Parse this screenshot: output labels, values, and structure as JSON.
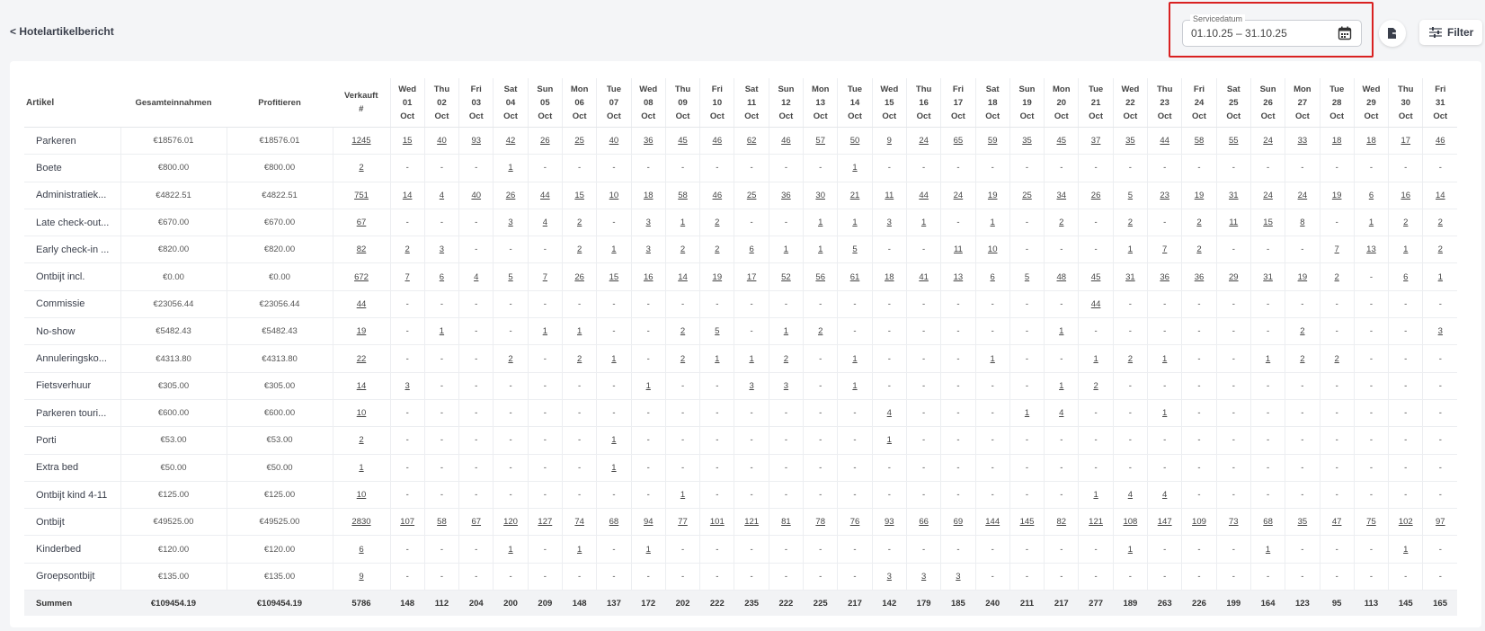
{
  "header": {
    "back_label": "< Hotelartikelbericht",
    "date_label": "Servicedatum",
    "date_range": "01.10.25 – 31.10.25",
    "filter_label": "Filter"
  },
  "table": {
    "col_artikel": "Artikel",
    "col_gesamt": "Gesamteinnahmen",
    "col_profit": "Profitieren",
    "col_verkauft": "Verkauft",
    "col_verkauft_sub": "#",
    "days": [
      {
        "name": "Wed",
        "num": "01",
        "mon": "Oct"
      },
      {
        "name": "Thu",
        "num": "02",
        "mon": "Oct"
      },
      {
        "name": "Fri",
        "num": "03",
        "mon": "Oct"
      },
      {
        "name": "Sat",
        "num": "04",
        "mon": "Oct"
      },
      {
        "name": "Sun",
        "num": "05",
        "mon": "Oct"
      },
      {
        "name": "Mon",
        "num": "06",
        "mon": "Oct"
      },
      {
        "name": "Tue",
        "num": "07",
        "mon": "Oct"
      },
      {
        "name": "Wed",
        "num": "08",
        "mon": "Oct"
      },
      {
        "name": "Thu",
        "num": "09",
        "mon": "Oct"
      },
      {
        "name": "Fri",
        "num": "10",
        "mon": "Oct"
      },
      {
        "name": "Sat",
        "num": "11",
        "mon": "Oct"
      },
      {
        "name": "Sun",
        "num": "12",
        "mon": "Oct"
      },
      {
        "name": "Mon",
        "num": "13",
        "mon": "Oct"
      },
      {
        "name": "Tue",
        "num": "14",
        "mon": "Oct"
      },
      {
        "name": "Wed",
        "num": "15",
        "mon": "Oct"
      },
      {
        "name": "Thu",
        "num": "16",
        "mon": "Oct"
      },
      {
        "name": "Fri",
        "num": "17",
        "mon": "Oct"
      },
      {
        "name": "Sat",
        "num": "18",
        "mon": "Oct"
      },
      {
        "name": "Sun",
        "num": "19",
        "mon": "Oct"
      },
      {
        "name": "Mon",
        "num": "20",
        "mon": "Oct"
      },
      {
        "name": "Tue",
        "num": "21",
        "mon": "Oct"
      },
      {
        "name": "Wed",
        "num": "22",
        "mon": "Oct"
      },
      {
        "name": "Thu",
        "num": "23",
        "mon": "Oct"
      },
      {
        "name": "Fri",
        "num": "24",
        "mon": "Oct"
      },
      {
        "name": "Sat",
        "num": "25",
        "mon": "Oct"
      },
      {
        "name": "Sun",
        "num": "26",
        "mon": "Oct"
      },
      {
        "name": "Mon",
        "num": "27",
        "mon": "Oct"
      },
      {
        "name": "Tue",
        "num": "28",
        "mon": "Oct"
      },
      {
        "name": "Wed",
        "num": "29",
        "mon": "Oct"
      },
      {
        "name": "Thu",
        "num": "30",
        "mon": "Oct"
      },
      {
        "name": "Fri",
        "num": "31",
        "mon": "Oct"
      }
    ],
    "rows": [
      {
        "name": "Parkeren",
        "gesamt": "€18576.01",
        "profit": "€18576.01",
        "verkauft": "1245",
        "days": [
          "15",
          "40",
          "93",
          "42",
          "26",
          "25",
          "40",
          "36",
          "45",
          "46",
          "62",
          "46",
          "57",
          "50",
          "9",
          "24",
          "65",
          "59",
          "35",
          "45",
          "37",
          "35",
          "44",
          "58",
          "55",
          "24",
          "33",
          "18",
          "18",
          "17",
          "46"
        ]
      },
      {
        "name": "Boete",
        "gesamt": "€800.00",
        "profit": "€800.00",
        "verkauft": "2",
        "days": [
          "-",
          "-",
          "-",
          "1",
          "-",
          "-",
          "-",
          "-",
          "-",
          "-",
          "-",
          "-",
          "-",
          "1",
          "-",
          "-",
          "-",
          "-",
          "-",
          "-",
          "-",
          "-",
          "-",
          "-",
          "-",
          "-",
          "-",
          "-",
          "-",
          "-",
          "-"
        ]
      },
      {
        "name": "Administratiek...",
        "gesamt": "€4822.51",
        "profit": "€4822.51",
        "verkauft": "751",
        "days": [
          "14",
          "4",
          "40",
          "26",
          "44",
          "15",
          "10",
          "18",
          "58",
          "46",
          "25",
          "36",
          "30",
          "21",
          "11",
          "44",
          "24",
          "19",
          "25",
          "34",
          "26",
          "5",
          "23",
          "19",
          "31",
          "24",
          "24",
          "19",
          "6",
          "16",
          "14"
        ]
      },
      {
        "name": "Late check-out...",
        "gesamt": "€670.00",
        "profit": "€670.00",
        "verkauft": "67",
        "days": [
          "-",
          "-",
          "-",
          "3",
          "4",
          "2",
          "-",
          "3",
          "1",
          "2",
          "-",
          "-",
          "1",
          "1",
          "3",
          "1",
          "-",
          "1",
          "-",
          "2",
          "-",
          "2",
          "-",
          "2",
          "11",
          "15",
          "8",
          "-",
          "1",
          "2",
          "2"
        ]
      },
      {
        "name": "Early check-in ...",
        "gesamt": "€820.00",
        "profit": "€820.00",
        "verkauft": "82",
        "days": [
          "2",
          "3",
          "-",
          "-",
          "-",
          "2",
          "1",
          "3",
          "2",
          "2",
          "6",
          "1",
          "1",
          "5",
          "-",
          "-",
          "11",
          "10",
          "-",
          "-",
          "-",
          "1",
          "7",
          "2",
          "-",
          "-",
          "-",
          "7",
          "13",
          "1",
          "2"
        ]
      },
      {
        "name": "Ontbijt incl.",
        "gesamt": "€0.00",
        "profit": "€0.00",
        "verkauft": "672",
        "days": [
          "7",
          "6",
          "4",
          "5",
          "7",
          "26",
          "15",
          "16",
          "14",
          "19",
          "17",
          "52",
          "56",
          "61",
          "18",
          "41",
          "13",
          "6",
          "5",
          "48",
          "45",
          "31",
          "36",
          "36",
          "29",
          "31",
          "19",
          "2",
          "-",
          "6",
          "1"
        ]
      },
      {
        "name": "Commissie",
        "gesamt": "€23056.44",
        "profit": "€23056.44",
        "verkauft": "44",
        "days": [
          "-",
          "-",
          "-",
          "-",
          "-",
          "-",
          "-",
          "-",
          "-",
          "-",
          "-",
          "-",
          "-",
          "-",
          "-",
          "-",
          "-",
          "-",
          "-",
          "-",
          "44",
          "-",
          "-",
          "-",
          "-",
          "-",
          "-",
          "-",
          "-",
          "-",
          "-"
        ]
      },
      {
        "name": "No-show",
        "gesamt": "€5482.43",
        "profit": "€5482.43",
        "verkauft": "19",
        "days": [
          "-",
          "1",
          "-",
          "-",
          "1",
          "1",
          "-",
          "-",
          "2",
          "5",
          "-",
          "1",
          "2",
          "-",
          "-",
          "-",
          "-",
          "-",
          "-",
          "1",
          "-",
          "-",
          "-",
          "-",
          "-",
          "-",
          "2",
          "-",
          "-",
          "-",
          "3"
        ]
      },
      {
        "name": "Annuleringsko...",
        "gesamt": "€4313.80",
        "profit": "€4313.80",
        "verkauft": "22",
        "days": [
          "-",
          "-",
          "-",
          "2",
          "-",
          "2",
          "1",
          "-",
          "2",
          "1",
          "1",
          "2",
          "-",
          "1",
          "-",
          "-",
          "-",
          "1",
          "-",
          "-",
          "1",
          "2",
          "1",
          "-",
          "-",
          "1",
          "2",
          "2",
          "-",
          "-",
          "-"
        ]
      },
      {
        "name": "Fietsverhuur",
        "gesamt": "€305.00",
        "profit": "€305.00",
        "verkauft": "14",
        "days": [
          "3",
          "-",
          "-",
          "-",
          "-",
          "-",
          "-",
          "1",
          "-",
          "-",
          "3",
          "3",
          "-",
          "1",
          "-",
          "-",
          "-",
          "-",
          "-",
          "1",
          "2",
          "-",
          "-",
          "-",
          "-",
          "-",
          "-",
          "-",
          "-",
          "-",
          "-"
        ]
      },
      {
        "name": "Parkeren touri...",
        "gesamt": "€600.00",
        "profit": "€600.00",
        "verkauft": "10",
        "days": [
          "-",
          "-",
          "-",
          "-",
          "-",
          "-",
          "-",
          "-",
          "-",
          "-",
          "-",
          "-",
          "-",
          "-",
          "4",
          "-",
          "-",
          "-",
          "1",
          "4",
          "-",
          "-",
          "1",
          "-",
          "-",
          "-",
          "-",
          "-",
          "-",
          "-",
          "-"
        ]
      },
      {
        "name": "Porti",
        "gesamt": "€53.00",
        "profit": "€53.00",
        "verkauft": "2",
        "days": [
          "-",
          "-",
          "-",
          "-",
          "-",
          "-",
          "1",
          "-",
          "-",
          "-",
          "-",
          "-",
          "-",
          "-",
          "1",
          "-",
          "-",
          "-",
          "-",
          "-",
          "-",
          "-",
          "-",
          "-",
          "-",
          "-",
          "-",
          "-",
          "-",
          "-",
          "-"
        ]
      },
      {
        "name": "Extra bed",
        "gesamt": "€50.00",
        "profit": "€50.00",
        "verkauft": "1",
        "days": [
          "-",
          "-",
          "-",
          "-",
          "-",
          "-",
          "1",
          "-",
          "-",
          "-",
          "-",
          "-",
          "-",
          "-",
          "-",
          "-",
          "-",
          "-",
          "-",
          "-",
          "-",
          "-",
          "-",
          "-",
          "-",
          "-",
          "-",
          "-",
          "-",
          "-",
          "-"
        ]
      },
      {
        "name": "Ontbijt kind 4-11",
        "gesamt": "€125.00",
        "profit": "€125.00",
        "verkauft": "10",
        "days": [
          "-",
          "-",
          "-",
          "-",
          "-",
          "-",
          "-",
          "-",
          "1",
          "-",
          "-",
          "-",
          "-",
          "-",
          "-",
          "-",
          "-",
          "-",
          "-",
          "-",
          "1",
          "4",
          "4",
          "-",
          "-",
          "-",
          "-",
          "-",
          "-",
          "-",
          "-"
        ]
      },
      {
        "name": "Ontbijt",
        "gesamt": "€49525.00",
        "profit": "€49525.00",
        "verkauft": "2830",
        "days": [
          "107",
          "58",
          "67",
          "120",
          "127",
          "74",
          "68",
          "94",
          "77",
          "101",
          "121",
          "81",
          "78",
          "76",
          "93",
          "66",
          "69",
          "144",
          "145",
          "82",
          "121",
          "108",
          "147",
          "109",
          "73",
          "68",
          "35",
          "47",
          "75",
          "102",
          "97"
        ]
      },
      {
        "name": "Kinderbed",
        "gesamt": "€120.00",
        "profit": "€120.00",
        "verkauft": "6",
        "days": [
          "-",
          "-",
          "-",
          "1",
          "-",
          "1",
          "-",
          "1",
          "-",
          "-",
          "-",
          "-",
          "-",
          "-",
          "-",
          "-",
          "-",
          "-",
          "-",
          "-",
          "-",
          "1",
          "-",
          "-",
          "-",
          "1",
          "-",
          "-",
          "-",
          "1",
          "-"
        ]
      },
      {
        "name": "Groepsontbijt",
        "gesamt": "€135.00",
        "profit": "€135.00",
        "verkauft": "9",
        "days": [
          "-",
          "-",
          "-",
          "-",
          "-",
          "-",
          "-",
          "-",
          "-",
          "-",
          "-",
          "-",
          "-",
          "-",
          "3",
          "3",
          "3",
          "-",
          "-",
          "-",
          "-",
          "-",
          "-",
          "-",
          "-",
          "-",
          "-",
          "-",
          "-",
          "-",
          "-"
        ]
      }
    ],
    "totals": {
      "name": "Summen",
      "gesamt": "€109454.19",
      "profit": "€109454.19",
      "verkauft": "5786",
      "days": [
        "148",
        "112",
        "204",
        "200",
        "209",
        "148",
        "137",
        "172",
        "202",
        "222",
        "235",
        "222",
        "225",
        "217",
        "142",
        "179",
        "185",
        "240",
        "211",
        "217",
        "277",
        "189",
        "263",
        "226",
        "199",
        "164",
        "123",
        "95",
        "113",
        "145",
        "165"
      ]
    }
  }
}
